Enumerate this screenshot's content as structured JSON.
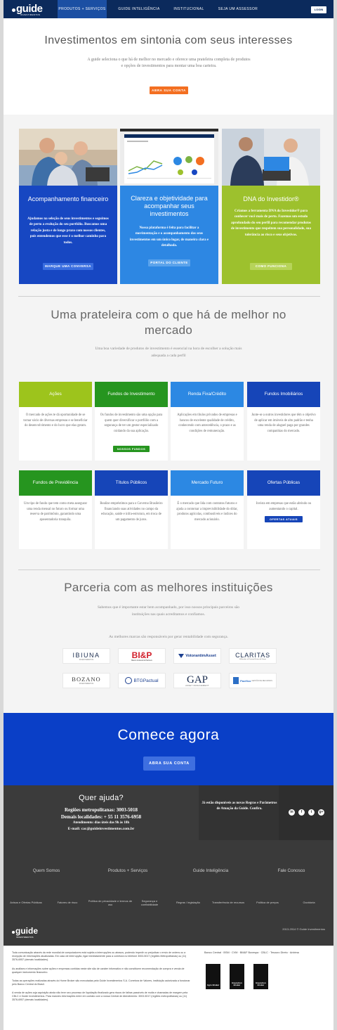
{
  "nav": {
    "logo_text": "guide",
    "logo_sub": "INVESTIMENTOS",
    "items": [
      {
        "label": "PRODUTOS + SERVIÇOS"
      },
      {
        "label": "GUIDE INTELIGÊNCIA"
      },
      {
        "label": "INSTITUCIONAL"
      },
      {
        "label": "SEJA UM ASSESSOR"
      }
    ],
    "login": "LOGIN"
  },
  "hero": {
    "title": "Investimentos em sintonia com seus interesses",
    "text": "A guide seleciona o que há de melhor no mercado e oferece uma prateleira completa de produtos e opções de investimentos para montar uma boa carteira.",
    "button": "ABRA SUA CONTA"
  },
  "cards": [
    {
      "title": "Acompanhamento financeiro",
      "text": "Ajudamos na seleção de seus investimentos e seguimos de perto a evolução do seu portfólio. Buscamos uma relação justa e de longo prazo com nossos clientes, pois entendemos que esse é o melhor caminho para todos.",
      "button": "MARQUE UMA CONVERSA",
      "color": "#1747c2"
    },
    {
      "title": "Clareza e objetividade para acompanhar seus investimentos",
      "text": "Nossa plataforma é feita para facilitar a movimentação e o acompanhamento dos seus investimentos em um único lugar, de maneira clara e detalhada.",
      "button": "PORTAL DO CLIENTE",
      "color": "#2d87e3"
    },
    {
      "title": "DNA do Investidor®",
      "text": "Criamos a ferramenta DNA do Investidor® para conhecer você mais de perto. Fazemos um estudo aprofundado do seu perfil para recomendar produtos de investimento que respeitem sua personalidade, sua tolerância ao risco e seus objetivos.",
      "button": "COMO FUNCIONA",
      "color": "#9dc12d"
    }
  ],
  "shelf": {
    "title": "Uma prateleira com o que há de melhor no mercado",
    "text": "Uma boa variedade de produtos de investimento é essencial na hora de escolher a solução mais adequada a cada perfil"
  },
  "products": [
    {
      "title": "Ações",
      "text": "O mercado de ações te dá oportunidade de se tornar sócio de diversas empresas e se beneficiar do desenvolvimento e do lucro que elas geram.",
      "button": "",
      "color": "#9dc41c"
    },
    {
      "title": "Fundos de Investimento",
      "text": "Os fundos de investimento são uma opção para quem quer diversificar o portfólio com a segurança de ter um gestor especializado cuidando da sua aplicação.",
      "button": "NOSSOS FUNDOS",
      "color": "#26951f"
    },
    {
      "title": "Renda Fixa/Crédito",
      "text": "Aplicações em títulos privados de empresas e bancos de excelente qualidade de crédito, conhecendo com antecedência, o prazo e as condições de remuneração.",
      "button": "",
      "color": "#2c88e3"
    },
    {
      "title": "Fundos Imobiliários",
      "text": "Junte-se a outros investidores que têm o objetivo de aplicar em imóveis de alto padrão e tenha uma renda de aluguel paga por grandes companhias do mercado.",
      "button": "",
      "color": "#1645b8"
    },
    {
      "title": "Fundos de Previdência",
      "text": "Um tipo de fundo que tem como meta assegurar uma renda mensal no futuro ou formar uma reserva de patrimônio, garantindo uma aposentadoria tranquila.",
      "button": "",
      "color": "#26951f"
    },
    {
      "title": "Títulos Públicos",
      "text": "Realize empréstimos para o Governo Brasileiro financiando suas atividades no campo da educação, saúde e infra-estrutura, em troca de um pagamento de juros.",
      "button": "",
      "color": "#1645b8"
    },
    {
      "title": "Mercado Futuro",
      "text": "É o mercado que lida com contratos futuros e ajuda a contornar a imprevisibilidade do dólar, produtos agrícolas, combustíveis e índices do mercado acionário.",
      "button": "",
      "color": "#2c88e3"
    },
    {
      "title": "Ofertas Públicas",
      "text": "Invista em empresas que estão abrindo ou aumentando o capital.",
      "button": "OFERTAS ATUAIS",
      "color": "#1645b8"
    }
  ],
  "partners": {
    "title": "Parceria com as melhores instituições",
    "text": "Sabemos que é importante estar bem acompanhado, por isso nossos principais parceiros são instituições nas quais acreditamos e confiamos.",
    "subtitle": "As melhores marcas são responsáveis por gerar rentabilidade com segurança.",
    "logos": [
      "IBIUNA",
      "BI&P",
      "VotorantimAsset",
      "CLARITAS",
      "BOZANO",
      "BTGPactual",
      "GAP",
      "Pacifico"
    ],
    "logo_subs": [
      "INVESTIMENTOS",
      "Banco Indusval & Partners",
      "",
      "A Member of Principal Financial Group",
      "INVESTIMENTOS",
      "",
      "ASSET MANAGEMENT",
      "GESTÃO DE RECURSOS"
    ]
  },
  "comece": {
    "title": "Comece agora",
    "button": "ABRA SUA CONTA"
  },
  "help": {
    "title": "Quer ajuda?",
    "metro": "Regiões metropolitanas: 3003-5018",
    "demais": "Demais localidades: + 55 11 3576-6958",
    "atendimento": "Atendimento: dias úteis das 9h às 18h",
    "email": "E-mail: cac@guideinvestimentos.com.br",
    "news": "Já estão disponíveis as novas Regras e Parâmetros de Atuação da Guide. Confira."
  },
  "footer": {
    "columns": [
      "Quem Somos",
      "Produtos + Serviços",
      "Guide Inteligência",
      "Fale Conosco"
    ],
    "links": [
      "Avisos e Ofertas Públicas",
      "Fatores de risco",
      "Política de privacidade e termos de uso",
      "Segurança e confiabilidade",
      "Regras / legislação",
      "Transferência de recursos",
      "Política de preços",
      "Ouvidoria"
    ],
    "logo_text": "guide",
    "logo_sub": "INVESTIMENTOS",
    "copyright": "2013-2014 © Guide Investimentos",
    "paragraphs": [
      "Toda comunicação através da rede mundial de computadores está sujeita a interrupções ou atrasos, podendo impedir ou prejudicar o envio de ordens ou a recepção de informações atualizadas. Em caso de interrupção, ligar imediatamente para a corretora no telefone 3003-5017 (regiões Metropolitanas) ou (11) 3576-6957 (demais localidades).",
      "As análises e informações sobre ações e empresas contidas neste site são de caráter informativo e não constituem recomendação de compra e venda de qualquer instrumento financeiro.",
      "Todas as operações realizadas através do Home Broker são executadas pela Guide Investimentos S.A. Corretora de Valores, instituição autorizada a funcionar pelo Banco Central do Brasil.",
      "A venda de ações cuja aquisição ainda não teve seu processo de liquidação finalizado gera riscos de falhas passíveis de multa e chamadas de margem pela CBLC e Guide Investimentos. Para maiores informações entre em contato com a nossa Central de Atendimento: 3003-5017 (regiões metropolitanas) ou (11) 3576-6957 (demais localidades)."
    ],
    "partner_links": "Banco Central  ·  BSM  ·  CVM  ·  BM&F Bovespa  ·  CBLC  ·  Tesouro Direto  ·  Anbima",
    "badges": [
      "Agro Broker",
      "Execution Broker",
      "Execution Broker"
    ]
  },
  "colors": {
    "nav": "#0b2a5c",
    "orange": "#f36f21",
    "blue": "#0a3fc7"
  }
}
